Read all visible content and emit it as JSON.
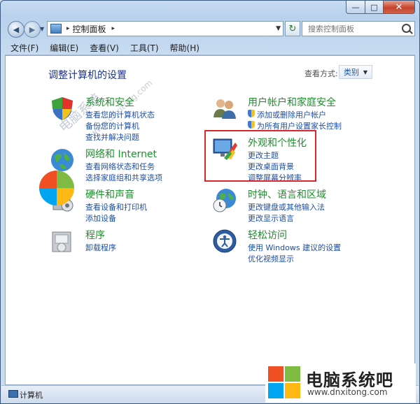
{
  "window": {
    "minimize": "—",
    "maximize": "□",
    "close": "✕"
  },
  "address": {
    "root_label": "控制面板",
    "sep": "▸"
  },
  "search": {
    "placeholder": "搜索控制面板"
  },
  "menu": [
    "文件(F)",
    "编辑(E)",
    "查看(V)",
    "工具(T)",
    "帮助(H)"
  ],
  "page": {
    "title": "调整计算机的设置",
    "view_by_label": "查看方式:",
    "view_by_value": "类别"
  },
  "categories_left": [
    {
      "icon": "security-shield-icon",
      "title": "系统和安全",
      "links": [
        "查看您的计算机状态",
        "备份您的计算机",
        "查找并解决问题"
      ]
    },
    {
      "icon": "network-globe-icon",
      "title": "网络和 Internet",
      "links": [
        "查看网络状态和任务",
        "选择家庭组和共享选项"
      ]
    },
    {
      "icon": "hardware-sound-icon",
      "title": "硬件和声音",
      "links": [
        "查看设备和打印机",
        "添加设备"
      ]
    },
    {
      "icon": "programs-icon",
      "title": "程序",
      "links": [
        "卸载程序"
      ]
    }
  ],
  "categories_right": [
    {
      "icon": "user-accounts-icon",
      "title": "用户帐户和家庭安全",
      "links": [
        "添加或删除用户帐户",
        "为所有用户设置家长控制"
      ]
    },
    {
      "icon": "appearance-display-icon",
      "title": "外观和个性化",
      "links": [
        "更改主题",
        "更改桌面背景",
        "调整屏幕分辨率"
      ]
    },
    {
      "icon": "clock-globe-icon",
      "title": "时钟、语言和区域",
      "links": [
        "更改键盘或其他输入法",
        "更改显示语言"
      ]
    },
    {
      "icon": "ease-of-access-icon",
      "title": "轻松访问",
      "links": [
        "使用 Windows 建议的设置",
        "优化视频显示"
      ]
    }
  ],
  "status": {
    "text": "计算机"
  },
  "watermark": {
    "text": "电脑系统",
    "url": "www.dnxitong.com"
  },
  "brand": {
    "name": "电脑系统吧",
    "url": "www.dnxitong.com"
  },
  "colors": {
    "category_title": "#1e8e2e",
    "link": "#1e4ea5",
    "title": "#1e3287",
    "highlight": "#d9262c"
  }
}
